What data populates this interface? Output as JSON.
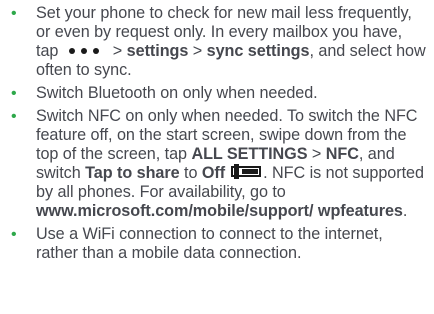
{
  "bullet_symbol": "•",
  "items": [
    {
      "t1": "Set your phone to check for new mail less frequently, or even by request only. In every mailbox you have, tap",
      "icon": "more-dots-icon",
      "t2": " > ",
      "b1": "settings",
      "t3": " > ",
      "b2": "sync settings",
      "t4": ", and select how often to sync."
    },
    {
      "text": "Switch Bluetooth on only when needed."
    },
    {
      "t1": "Switch NFC on only when needed. To switch the NFC feature off, on the start screen, swipe down from the top of the screen, tap ",
      "b1": "ALL SETTINGS",
      "t2": " > ",
      "b2": "NFC",
      "t3": ", and switch ",
      "b3": "Tap to share",
      "t4": " to ",
      "b4": "Off",
      "icon": "toggle-off-icon",
      "t5": ". NFC is not supported by all phones. For availability, go to ",
      "b5": "www.microsoft.com/mobile/support/ wpfeatures",
      "t6": "."
    },
    {
      "text": "Use a WiFi connection to connect to the internet, rather than a mobile data connection."
    }
  ],
  "colors": {
    "bullet": "#2ea84a",
    "text": "#46484f",
    "icon": "#1a1a1a"
  }
}
